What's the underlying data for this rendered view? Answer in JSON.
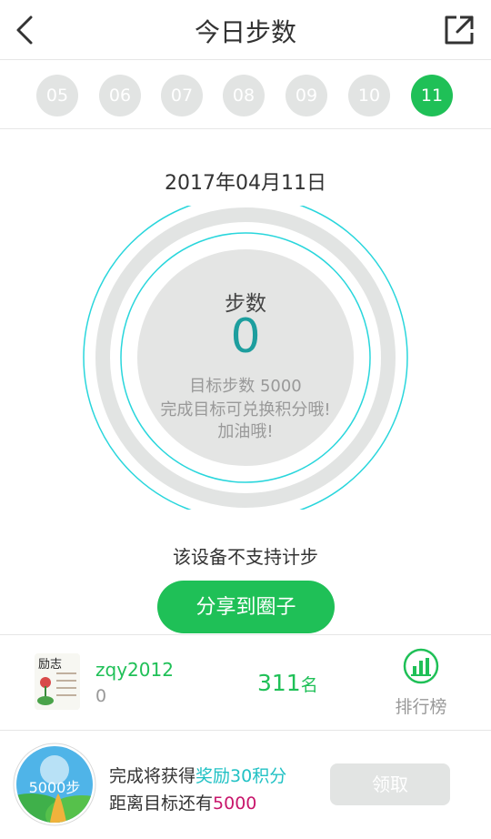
{
  "header": {
    "title": "今日步数"
  },
  "days": [
    {
      "label": "05",
      "active": false
    },
    {
      "label": "06",
      "active": false
    },
    {
      "label": "07",
      "active": false
    },
    {
      "label": "08",
      "active": false
    },
    {
      "label": "09",
      "active": false
    },
    {
      "label": "10",
      "active": false
    },
    {
      "label": "11",
      "active": true
    }
  ],
  "date": "2017年04月11日",
  "steps": {
    "label": "步数",
    "value": "0",
    "goal": "目标步数 5000",
    "tip1": "完成目标可兑换积分哦!",
    "tip2": "加油哦!"
  },
  "unsupported": "该设备不支持计步",
  "share_button": "分享到圈子",
  "user": {
    "name": "zqy2012",
    "points": "0",
    "rank": "311",
    "rank_unit": "名",
    "leaderboard_label": "排行榜",
    "avatar_text": "励志"
  },
  "reward": {
    "badge": "5000步",
    "line1_prefix": "完成将获得",
    "line1_highlight": "奖励30积分",
    "line2_prefix": "距离目标还有",
    "line2_highlight": "5000",
    "claim": "领取"
  },
  "colors": {
    "accent": "#1fc057",
    "inactive": "#e2e4e3",
    "teal": "#1d9e9e",
    "ring_line": "#29d6dc",
    "highlight_red": "#c8166b"
  },
  "icons": {
    "back": "back-arrow-icon",
    "share": "external-link-icon",
    "leaderboard": "bar-chart-icon"
  }
}
